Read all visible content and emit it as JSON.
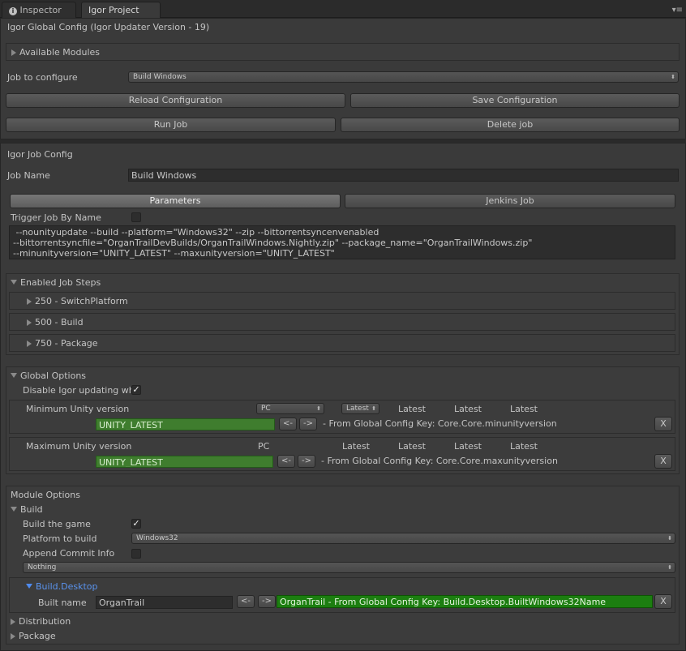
{
  "tabs": [
    {
      "label": "Inspector",
      "icon": "info-icon"
    },
    {
      "label": "Igor Project Con"
    }
  ],
  "global": {
    "title": "Igor Global Config (Igor Updater Version - 19)",
    "available_modules": "Available Modules",
    "job_to_configure_label": "Job to configure",
    "job_to_configure_value": "Build Windows",
    "reload_label": "Reload Configuration",
    "save_label": "Save Configuration",
    "run_label": "Run Job",
    "delete_label": "Delete job"
  },
  "job": {
    "title": "Igor Job Config",
    "name_label": "Job Name",
    "name_value": "Build Windows",
    "tab_parameters": "Parameters",
    "tab_jenkins": "Jenkins Job",
    "trigger_label": "Trigger Job By Name",
    "trigger_checked": false,
    "params_text": " --nounityupdate --build --platform=\"Windows32\" --zip --bittorrentsyncenvenabled\n--bittorrentsyncfile=\"OrganTrailDevBuilds/OrganTrailWindows.Nightly.zip\" --package_name=\"OrganTrailWindows.zip\"\n--minunityversion=\"UNITY_LATEST\" --maxunityversion=\"UNITY_LATEST\""
  },
  "steps": {
    "title": "Enabled Job Steps",
    "items": [
      "250 - SwitchPlatform",
      "500 - Build",
      "750 - Package"
    ]
  },
  "global_options": {
    "title": "Global Options",
    "disable_label": "Disable Igor updating wh",
    "disable_checked": true,
    "min": {
      "label": "Minimum Unity version",
      "platform": "PC",
      "latest_popup": "Latest",
      "latest_cols": [
        "Latest",
        "Latest",
        "Latest"
      ],
      "value": "UNITY_LATEST",
      "prev": "<-",
      "next": "->",
      "source": "- From Global Config Key: Core.Core.minunityversion",
      "clear": "X"
    },
    "max": {
      "label": "Maximum Unity version",
      "platform": "PC",
      "latest_cols": [
        "Latest",
        "Latest",
        "Latest",
        "Latest"
      ],
      "value": "UNITY_LATEST",
      "prev": "<-",
      "next": "->",
      "source": "- From Global Config Key: Core.Core.maxunityversion",
      "clear": "X"
    }
  },
  "module_options": {
    "title": "Module Options",
    "build_title": "Build",
    "build_game_label": "Build the game",
    "build_game_checked": true,
    "platform_label": "Platform to build",
    "platform_value": "Windows32",
    "append_label": "Append Commit Info",
    "append_checked": false,
    "nothing_value": "Nothing",
    "desktop_title": "Build.Desktop",
    "built_name_label": "Built name",
    "built_name_value": "OrganTrail",
    "prev": "<-",
    "next": "->",
    "built_source": "OrganTrail - From Global Config Key: Build.Desktop.BuiltWindows32Name",
    "clear": "X",
    "distribution": "Distribution",
    "package": "Package"
  },
  "colors": {
    "background": "#383838",
    "override_green": "#3f7d2e",
    "source_green": "#1c7e10",
    "accent_blue": "#5a93ee"
  }
}
